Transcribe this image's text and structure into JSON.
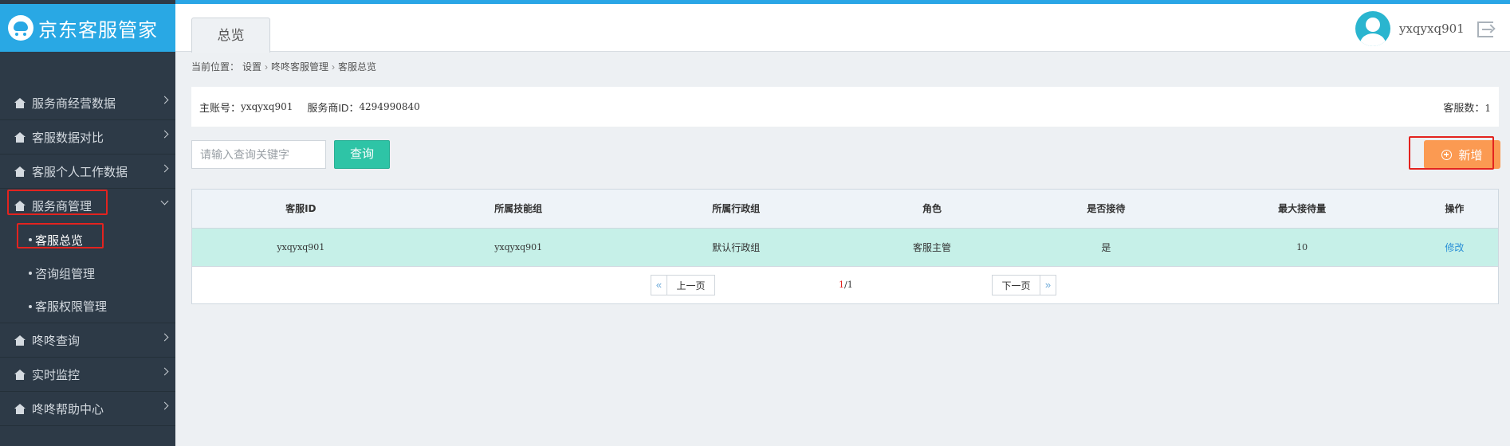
{
  "app": {
    "brand": "京东客服管家"
  },
  "header": {
    "tab": "总览",
    "username": "yxqyxq901"
  },
  "sidebar": {
    "items": [
      {
        "label": "服务商经营数据"
      },
      {
        "label": "客服数据对比"
      },
      {
        "label": "客服个人工作数据"
      },
      {
        "label": "服务商管理"
      }
    ],
    "subitems": [
      {
        "label": "客服总览"
      },
      {
        "label": "咨询组管理"
      },
      {
        "label": "客服权限管理"
      }
    ],
    "bottom_items": [
      {
        "label": "咚咚查询"
      },
      {
        "label": "实时监控"
      },
      {
        "label": "咚咚帮助中心"
      }
    ]
  },
  "breadcrumb": {
    "prefix": "当前位置：",
    "items": [
      "设置",
      "咚咚客服管理",
      "客服总览"
    ]
  },
  "info": {
    "account_label": "主账号：",
    "account_value": "yxqyxq901",
    "vendor_label": "服务商ID：",
    "vendor_value": "4294990840",
    "count_label": "客服数：",
    "count_value": "1"
  },
  "search": {
    "placeholder": "请输入查询关键字",
    "button": "查询"
  },
  "add_button": "新增",
  "table": {
    "headers": [
      "客服ID",
      "所属技能组",
      "所属行政组",
      "角色",
      "是否接待",
      "最大接待量",
      "操作"
    ],
    "rows": [
      [
        "yxqyxq901",
        "yxqyxq901",
        "默认行政组",
        "客服主管",
        "是",
        "10",
        "修改"
      ]
    ]
  },
  "pager": {
    "prev": "上一页",
    "next": "下一页",
    "current": "1",
    "total": "/1",
    "prev_arrow": "«",
    "next_arrow": "»"
  },
  "colors": {
    "brand": "#29a8e4",
    "sidebar": "#2d3a47",
    "search_button": "#2ec4a6",
    "add_button": "#fb9a52",
    "highlight_row": "#c6f0e8",
    "annotation": "#e3231f"
  }
}
